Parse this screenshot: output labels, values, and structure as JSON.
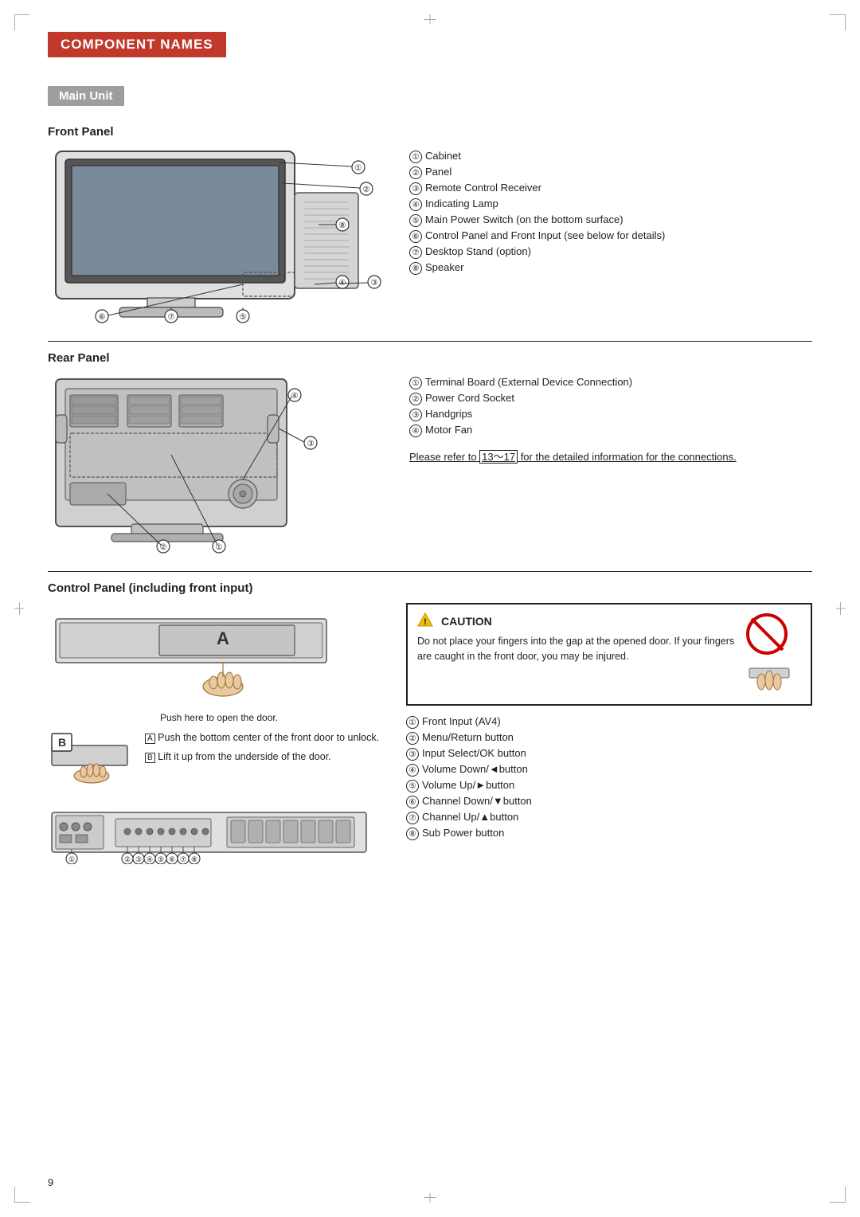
{
  "page": {
    "number": "9"
  },
  "header": {
    "banner": "COMPONENT NAMES",
    "sub_banner": "Main Unit"
  },
  "front_panel": {
    "title": "Front Panel",
    "items": [
      {
        "num": "①",
        "label": "Cabinet"
      },
      {
        "num": "②",
        "label": "Panel"
      },
      {
        "num": "③",
        "label": "Remote Control Receiver"
      },
      {
        "num": "④",
        "label": "Indicating Lamp"
      },
      {
        "num": "⑤",
        "label": "Main Power Switch (on the bottom surface)"
      },
      {
        "num": "⑥",
        "label": "Control Panel and Front Input (see below for details)"
      },
      {
        "num": "⑦",
        "label": "Desktop Stand (option)"
      },
      {
        "num": "⑧",
        "label": "Speaker"
      }
    ]
  },
  "rear_panel": {
    "title": "Rear Panel",
    "items": [
      {
        "num": "①",
        "label": "Terminal Board (External Device Connection)"
      },
      {
        "num": "②",
        "label": "Power Cord Socket"
      },
      {
        "num": "③",
        "label": "Handgrips"
      },
      {
        "num": "④",
        "label": "Motor Fan"
      }
    ],
    "note_link": "Please refer to",
    "note_pages": "13～17",
    "note_rest": "for the detailed information for the connections."
  },
  "control_panel": {
    "title": "Control Panel (including front input)",
    "push_text": "Push here to open the door.",
    "door_a_label": "A",
    "door_b_label": "B",
    "step_a": "Push the bottom center of the front door to unlock.",
    "step_b": "Lift it up from the underside of the door.",
    "caution_title": "CAUTION",
    "caution_text": "Do not place your fingers into the gap at the opened door. If your fingers are caught in the front door, you may be injured.",
    "items": [
      {
        "num": "①",
        "label": "Front Input (AV4)"
      },
      {
        "num": "②",
        "label": "Menu/Return button"
      },
      {
        "num": "③",
        "label": "Input Select/OK button"
      },
      {
        "num": "④",
        "label": "Volume Down/◄button"
      },
      {
        "num": "⑤",
        "label": "Volume Up/►button"
      },
      {
        "num": "⑥",
        "label": "Channel Down/▼button"
      },
      {
        "num": "⑦",
        "label": "Channel Up/▲button"
      },
      {
        "num": "⑧",
        "label": "Sub Power button"
      }
    ]
  }
}
